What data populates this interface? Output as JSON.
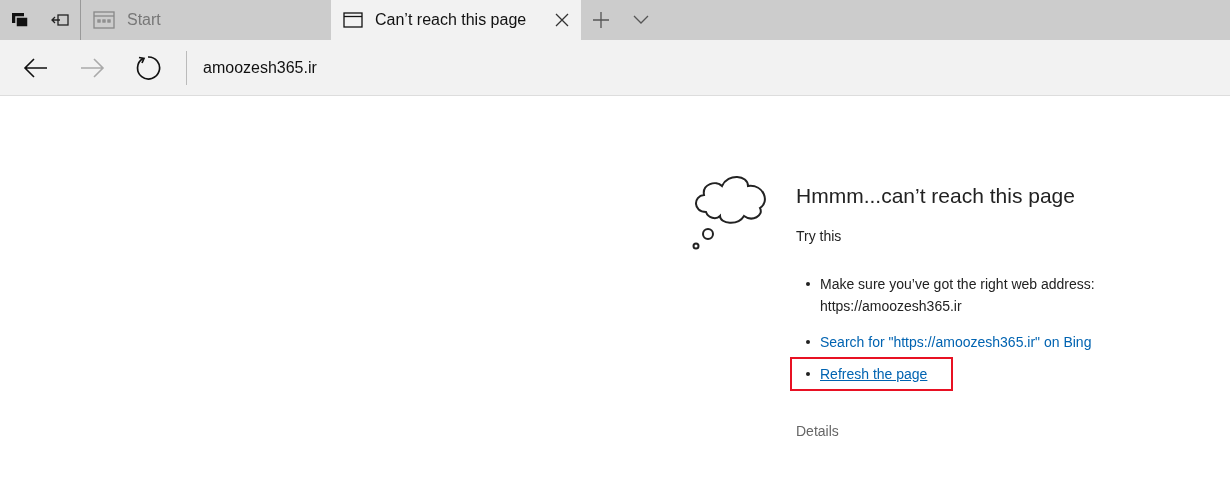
{
  "tabs": [
    {
      "label": "Start",
      "selected": false,
      "kind": "start"
    },
    {
      "label": "Can’t reach this page",
      "selected": true,
      "kind": "page"
    }
  ],
  "toolbar": {
    "back": {
      "disabled": false
    },
    "forward": {
      "disabled": true
    },
    "address": "amoozesh365.ir"
  },
  "error": {
    "title": "Hmmm...can’t reach this page",
    "subtitle": "Try this",
    "suggestions": [
      {
        "kind": "text",
        "lines": [
          "Make sure you’ve got the right web address:",
          "https://amoozesh365.ir"
        ],
        "highlighted": false
      },
      {
        "kind": "link",
        "lines": [
          "Search for \"https://amoozesh365.ir\" on Bing"
        ],
        "highlighted": false
      },
      {
        "kind": "link",
        "lines": [
          "Refresh the page"
        ],
        "highlighted": true
      }
    ],
    "details": "Details"
  }
}
